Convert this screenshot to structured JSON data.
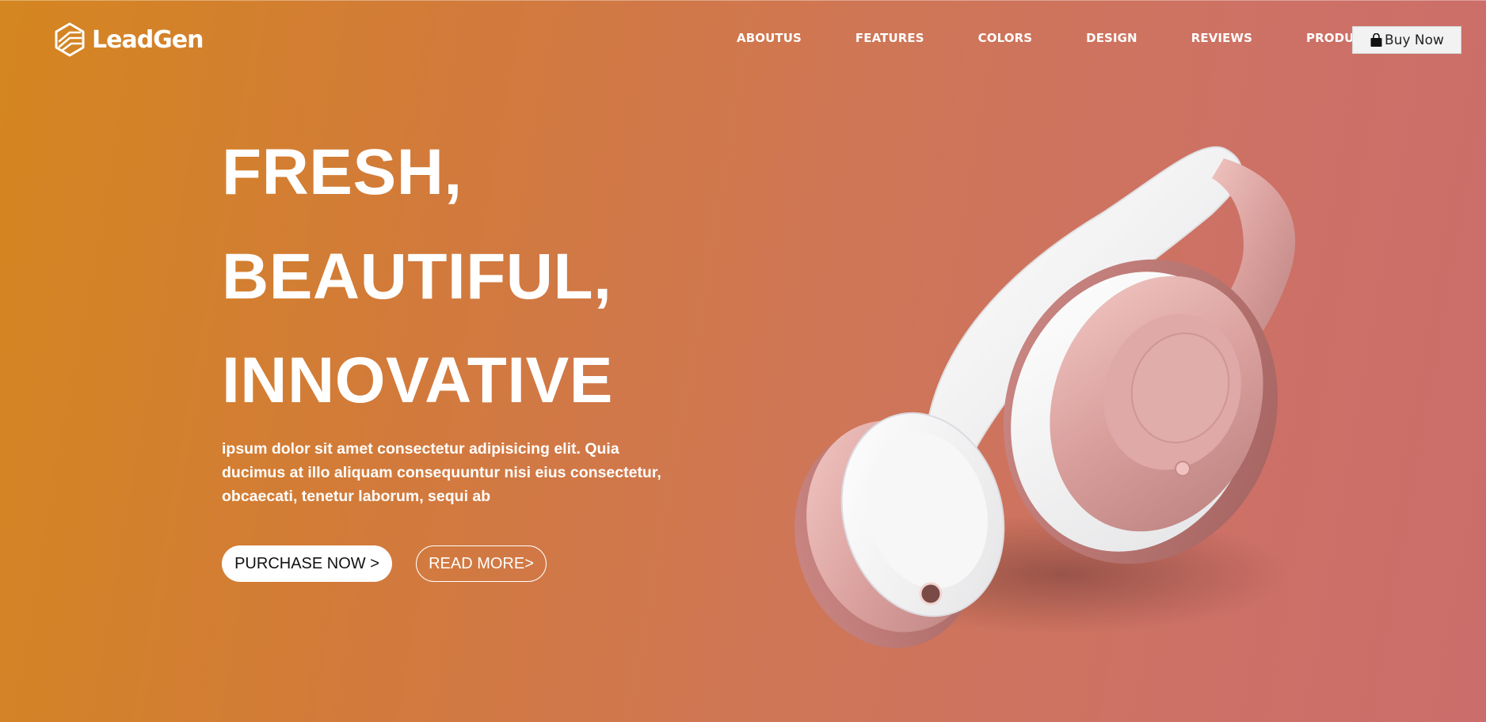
{
  "brand": {
    "name": "LeadGen",
    "logo_icon": "hexagon-logo-icon"
  },
  "nav": {
    "links": [
      "ABOUTUS",
      "FEATURES",
      "COLORS",
      "DESIGN",
      "REVIEWS",
      "PRODUCT"
    ],
    "buy_label": "Buy Now",
    "buy_icon": "shopping-bag-icon"
  },
  "hero": {
    "line1": "FRESH,",
    "line2": "BEAUTIFUL,",
    "line3": "INNOVATIVE",
    "description": "ipsum dolor sit amet consectetur adipisicing elit. Quia ducimus at illo aliquam consequuntur nisi eius consectetur, obcaecati, tenetur laborum, sequi ab",
    "primary_button": "PURCHASE NOW >",
    "secondary_button": "READ MORE>"
  },
  "product_image": {
    "subject": "rose-gold headphones"
  },
  "colors": {
    "gradient_start": "#d4861f",
    "gradient_end": "#cb6d6a",
    "text": "#ffffff"
  }
}
